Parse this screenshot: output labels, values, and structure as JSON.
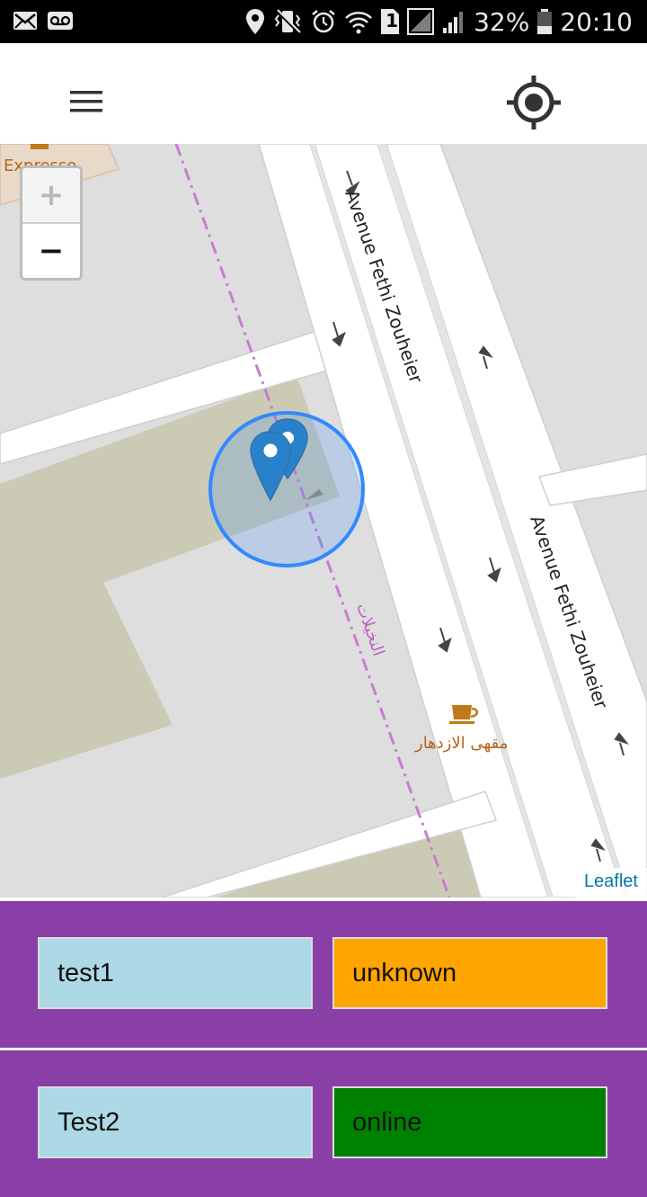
{
  "status_bar": {
    "battery_percent": "32%",
    "time": "20:10",
    "sim_slot": "1",
    "left_icons": [
      "mail-icon",
      "voicemail-icon"
    ],
    "right_icons": [
      "location-icon",
      "vibrate-icon",
      "alarm-icon",
      "wifi-icon",
      "sim-icon",
      "signal-icon",
      "signal-icon",
      "battery-icon"
    ]
  },
  "app_bar": {
    "menu_icon": "hamburger-menu-icon",
    "locate_icon": "my-location-icon"
  },
  "map": {
    "zoom_in_label": "+",
    "zoom_out_label": "−",
    "attribution": "Leaflet",
    "partial_poi_label": "Expresso",
    "street_1": "Avenue Fethi Zouheier",
    "street_2": "Avenue Fethi Zouheier",
    "cafe_label": "مقهى الازدهار",
    "tram_line_label": "النخيلات",
    "markers": 2,
    "accuracy_circle_color": "#3388ff",
    "marker_color": "#2a81cb"
  },
  "devices": [
    {
      "name": "test1",
      "status": "unknown",
      "status_color": "#ffa500"
    },
    {
      "name": "Test2",
      "status": "online",
      "status_color": "#008000"
    }
  ],
  "colors": {
    "list_background": "#8a3fa6",
    "name_background": "#add8e6"
  }
}
